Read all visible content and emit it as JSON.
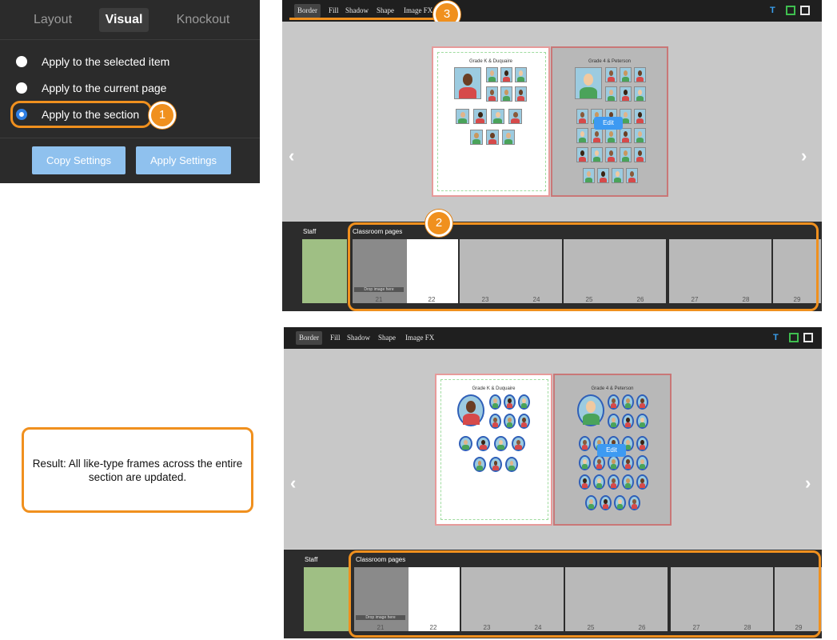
{
  "settings_panel": {
    "tabs": [
      {
        "label": "Layout",
        "active": false
      },
      {
        "label": "Visual",
        "active": true
      },
      {
        "label": "Knockout",
        "active": false
      }
    ],
    "options": [
      {
        "label": "Apply to the selected item",
        "selected": false
      },
      {
        "label": "Apply to the current page",
        "selected": false
      },
      {
        "label": "Apply to the section",
        "selected": true
      }
    ],
    "buttons": {
      "copy": "Copy Settings",
      "apply": "Apply Settings"
    }
  },
  "callouts": [
    "1",
    "2",
    "3"
  ],
  "editor_top": {
    "toolbar_tabs": [
      {
        "label": "Border",
        "active": true
      },
      {
        "label": "Fill",
        "active": false
      },
      {
        "label": "Shadow",
        "active": false
      },
      {
        "label": "Shape",
        "active": false
      },
      {
        "label": "Image FX",
        "active": false
      }
    ],
    "toolbar_icons": [
      "text-icon",
      "frame-icon",
      "image-icon"
    ],
    "left_page_title": "Grade K & Duquaire",
    "right_page_title": "Grade 4 & Peterson",
    "edit_label": "Edit",
    "photo_style": "square",
    "strip": {
      "section_labels": [
        "Staff",
        "Classroom pages"
      ],
      "drop_hint": "Drop image here",
      "page_numbers": [
        "21",
        "22",
        "23",
        "24",
        "25",
        "26",
        "27",
        "28",
        "29"
      ]
    }
  },
  "editor_bottom": {
    "toolbar_tabs": [
      {
        "label": "Border",
        "active": true
      },
      {
        "label": "Fill",
        "active": false
      },
      {
        "label": "Shadow",
        "active": false
      },
      {
        "label": "Shape",
        "active": false
      },
      {
        "label": "Image FX",
        "active": false
      }
    ],
    "toolbar_icons": [
      "text-icon",
      "frame-icon",
      "image-icon"
    ],
    "left_page_title": "Grade K & Duquaire",
    "right_page_title": "Grade 4 & Peterson",
    "edit_label": "Edit",
    "photo_style": "round",
    "strip": {
      "section_labels": [
        "Staff",
        "Classroom pages"
      ],
      "drop_hint": "Drop image here",
      "page_numbers": [
        "21",
        "22",
        "23",
        "24",
        "25",
        "26",
        "27",
        "28",
        "29"
      ]
    }
  },
  "result_note": "Result: All like-type frames across the entire section are updated.",
  "colors": {
    "accent_orange": "#f0901e",
    "radio_blue": "#2f7fe3",
    "button_blue": "#8fc1ee",
    "edit_blue": "#3d9af2",
    "frame_blue": "#2f5fb8"
  }
}
